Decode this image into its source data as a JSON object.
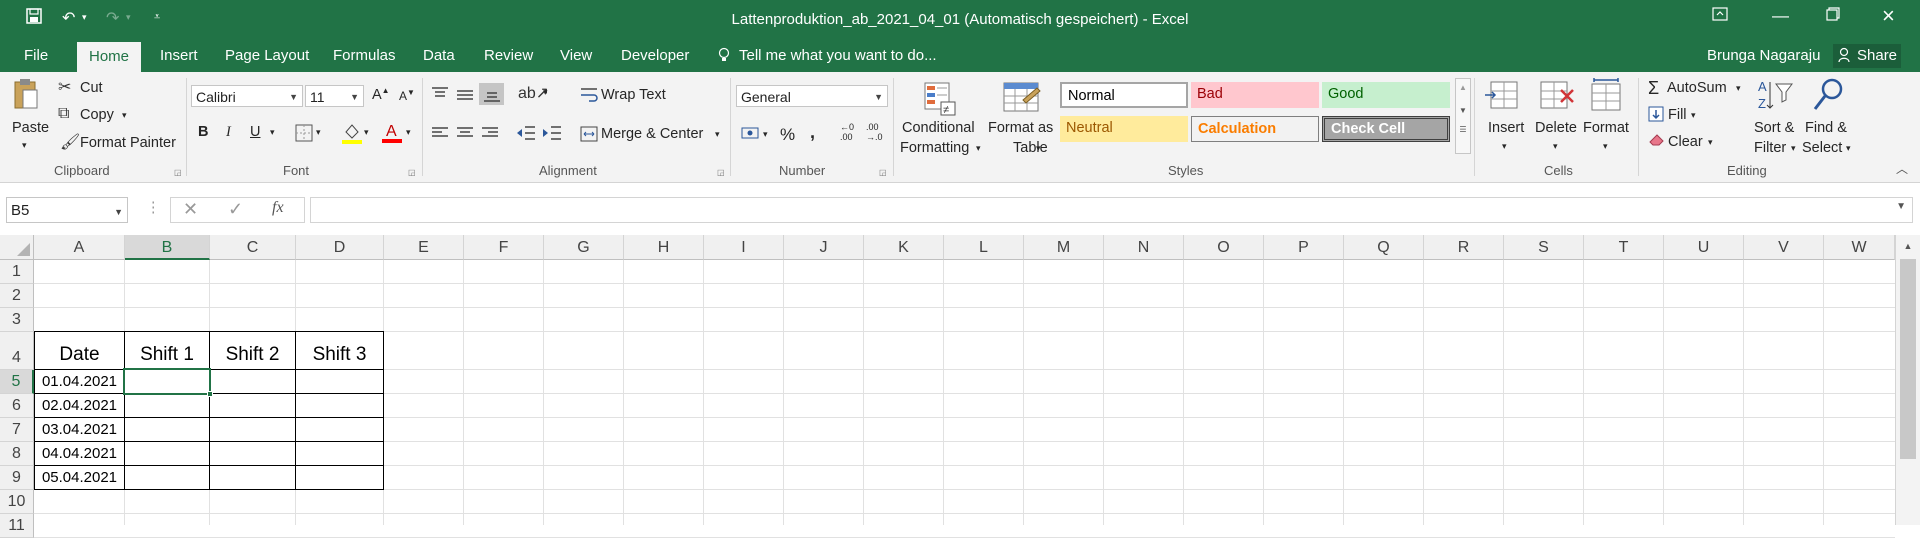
{
  "window": {
    "title": "Lattenproduktion_ab_2021_04_01 (Automatisch gespeichert) - Excel",
    "user": "Brunga Nagaraju",
    "share_label": "Share"
  },
  "tabs": [
    "File",
    "Home",
    "Insert",
    "Page Layout",
    "Formulas",
    "Data",
    "Review",
    "View",
    "Developer"
  ],
  "active_tab": "Home",
  "tell_me": "Tell me what you want to do...",
  "ribbon": {
    "clipboard": {
      "paste": "Paste",
      "cut": "Cut",
      "copy": "Copy",
      "format_painter": "Format Painter",
      "label": "Clipboard"
    },
    "font": {
      "name": "Calibri",
      "size": "11",
      "bold": "B",
      "italic": "I",
      "underline": "U",
      "label": "Font"
    },
    "alignment": {
      "wrap_text": "Wrap Text",
      "merge_center": "Merge & Center",
      "label": "Alignment"
    },
    "number": {
      "format": "General",
      "percent": "%",
      "comma": ",",
      "label": "Number"
    },
    "styles": {
      "conditional_1": "Conditional",
      "conditional_2": "Formatting",
      "format_as_1": "Format as",
      "format_as_2": "Table",
      "normal": "Normal",
      "bad": "Bad",
      "good": "Good",
      "neutral": "Neutral",
      "calculation": "Calculation",
      "check_cell": "Check Cell",
      "label": "Styles"
    },
    "cells": {
      "insert": "Insert",
      "delete": "Delete",
      "format": "Format",
      "label": "Cells"
    },
    "editing": {
      "autosum": "AutoSum",
      "fill": "Fill",
      "clear": "Clear",
      "sort_1": "Sort &",
      "sort_2": "Filter",
      "find_1": "Find &",
      "find_2": "Select",
      "label": "Editing"
    }
  },
  "formula_bar": {
    "name_box": "B5",
    "fx": "fx",
    "value": ""
  },
  "columns": [
    "A",
    "B",
    "C",
    "D",
    "E",
    "F",
    "G",
    "H",
    "I",
    "J",
    "K",
    "L",
    "M",
    "N",
    "O",
    "P",
    "Q",
    "R",
    "S",
    "T",
    "U",
    "V",
    "W"
  ],
  "rows": [
    "1",
    "2",
    "3",
    "4",
    "5",
    "6",
    "7",
    "8",
    "9",
    "10",
    "11"
  ],
  "selected_cell": "B5",
  "sheet": {
    "headers": [
      "Date",
      "Shift 1",
      "Shift 2",
      "Shift 3"
    ],
    "dates": [
      "01.04.2021",
      "02.04.2021",
      "03.04.2021",
      "04.04.2021",
      "05.04.2021"
    ]
  },
  "colors": {
    "excel_green": "#217346",
    "bad_bg": "#ffc7ce",
    "bad_fg": "#9c0006",
    "good_bg": "#c6efce",
    "good_fg": "#006100",
    "neutral_bg": "#ffeb9c",
    "neutral_fg": "#9c5700",
    "calc_fg": "#fa7d00",
    "check_bg": "#a5a5a5"
  }
}
